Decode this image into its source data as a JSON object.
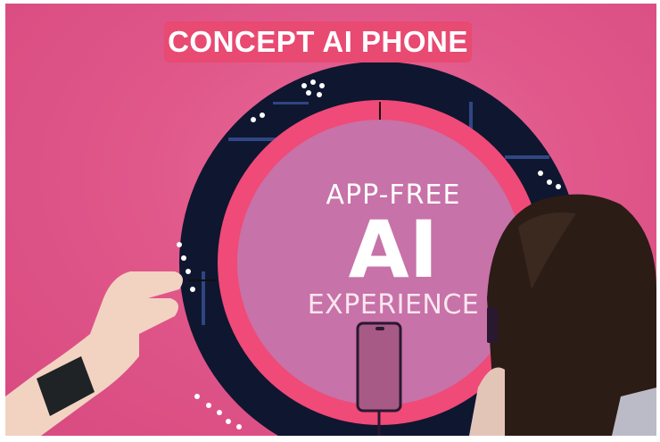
{
  "sign": {
    "text": "CONCEPT AI PHONE"
  },
  "display": {
    "line1": "APP-FREE",
    "line2": "AI",
    "line3": "EXPERIENCE"
  },
  "colors": {
    "background_pink": "#e0578a",
    "sign_red": "#e84a72",
    "ring_dark": "#0f1630",
    "inner_circle": "#c772a8"
  },
  "icons": [
    "phone-outline-icon"
  ]
}
